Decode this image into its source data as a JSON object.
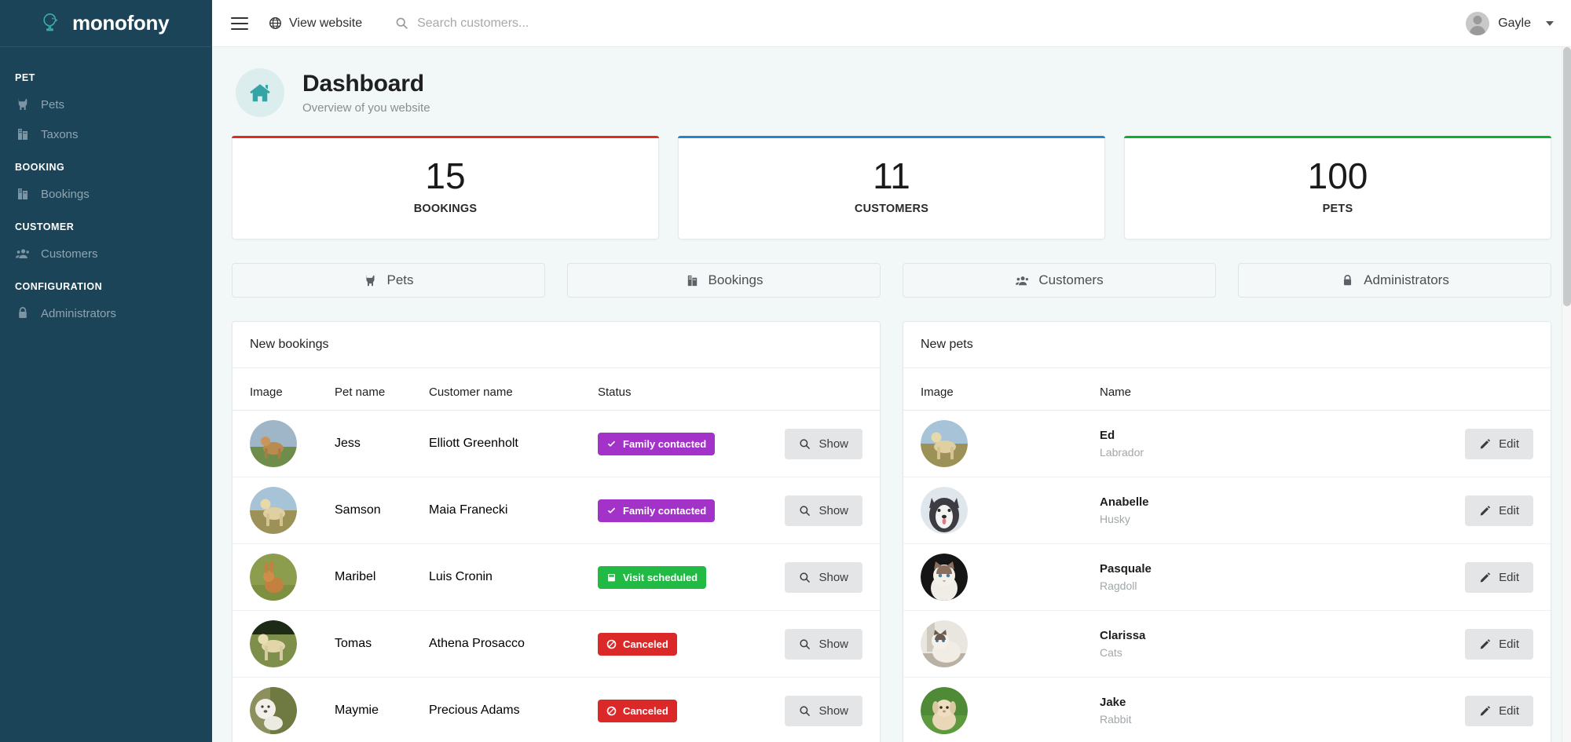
{
  "brand": {
    "name": "monofony",
    "logo_icon": "bird-icon"
  },
  "sidebar": {
    "sections": [
      {
        "title": "PET",
        "items": [
          {
            "label": "Pets",
            "icon": "cat-icon"
          },
          {
            "label": "Taxons",
            "icon": "building-icon"
          }
        ]
      },
      {
        "title": "BOOKING",
        "items": [
          {
            "label": "Bookings",
            "icon": "building-icon"
          }
        ]
      },
      {
        "title": "CUSTOMER",
        "items": [
          {
            "label": "Customers",
            "icon": "users-icon"
          }
        ]
      },
      {
        "title": "CONFIGURATION",
        "items": [
          {
            "label": "Administrators",
            "icon": "lock-icon"
          }
        ]
      }
    ]
  },
  "topbar": {
    "menu_icon": "hamburger-icon",
    "view_website": "View website",
    "view_website_icon": "globe-icon",
    "search_icon": "search-icon",
    "search_placeholder": "Search customers...",
    "search_value": "",
    "user_name": "Gayle",
    "user_avatar_icon": "avatar-icon",
    "caret_icon": "chevron-down-icon"
  },
  "page": {
    "icon": "home-icon",
    "title": "Dashboard",
    "subtitle": "Overview of you website"
  },
  "stats": [
    {
      "value": "15",
      "label": "BOOKINGS",
      "accent": "#e02b20"
    },
    {
      "value": "11",
      "label": "CUSTOMERS",
      "accent": "#2185d0"
    },
    {
      "value": "100",
      "label": "PETS",
      "accent": "#0ab12c"
    }
  ],
  "shortcuts": [
    {
      "label": "Pets",
      "icon": "cat-icon"
    },
    {
      "label": "Bookings",
      "icon": "building-icon"
    },
    {
      "label": "Customers",
      "icon": "users-icon"
    },
    {
      "label": "Administrators",
      "icon": "lock-icon"
    }
  ],
  "bookings_panel": {
    "title": "New bookings",
    "columns": [
      "Image",
      "Pet name",
      "Customer name",
      "Status",
      ""
    ],
    "action_label": "Show",
    "action_icon": "search-icon",
    "rows": [
      {
        "pet_name": "Jess",
        "customer_name": "Elliott Greenholt",
        "status": "Family contacted",
        "status_color": "#a333c8",
        "status_icon": "check-icon",
        "thumb": "dog-field"
      },
      {
        "pet_name": "Samson",
        "customer_name": "Maia Franecki",
        "status": "Family contacted",
        "status_color": "#a333c8",
        "status_icon": "check-icon",
        "thumb": "dog-labrador"
      },
      {
        "pet_name": "Maribel",
        "customer_name": "Luis Cronin",
        "status": "Visit scheduled",
        "status_color": "#21ba45",
        "status_icon": "calendar-icon",
        "thumb": "rabbit-grass"
      },
      {
        "pet_name": "Tomas",
        "customer_name": "Athena Prosacco",
        "status": "Canceled",
        "status_color": "#db2828",
        "status_icon": "ban-icon",
        "thumb": "dog-running"
      },
      {
        "pet_name": "Maymie",
        "customer_name": "Precious Adams",
        "status": "Canceled",
        "status_color": "#db2828",
        "status_icon": "ban-icon",
        "thumb": "dog-poodle"
      }
    ]
  },
  "pets_panel": {
    "title": "New pets",
    "columns": [
      "Image",
      "Name",
      ""
    ],
    "action_label": "Edit",
    "action_icon": "pencil-icon",
    "rows": [
      {
        "name": "Ed",
        "breed": "Labrador",
        "thumb": "dog-labrador"
      },
      {
        "name": "Anabelle",
        "breed": "Husky",
        "thumb": "husky"
      },
      {
        "name": "Pasquale",
        "breed": "Ragdoll",
        "thumb": "cat-ragdoll"
      },
      {
        "name": "Clarissa",
        "breed": "Cats",
        "thumb": "cat-siamese"
      },
      {
        "name": "Jake",
        "breed": "Rabbit",
        "thumb": "rabbit-lop"
      }
    ]
  },
  "colors": {
    "sidebar_bg": "#1b4458",
    "brand_teal": "#36a3a6",
    "page_bg": "#f2f7f7"
  }
}
